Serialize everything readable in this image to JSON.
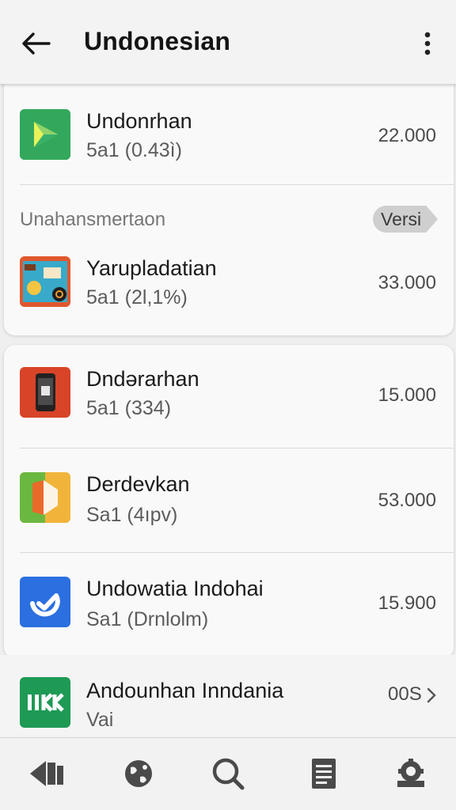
{
  "header": {
    "title": "Undonesian",
    "back_icon": "arrow-left-icon",
    "menu_icon": "more-vert-icon"
  },
  "card1": {
    "item1": {
      "name": "Undonrhan",
      "sub": "5a1 (0.43ì)",
      "price": "22.000",
      "icon": "play-store-icon"
    },
    "section_label": "Unahansmertaon",
    "badge": "Versi",
    "item2": {
      "name": "Yarupladatian",
      "sub": "5a1 (2l,1%)",
      "price": "33.000",
      "icon": "poster-app-icon"
    }
  },
  "card2": {
    "item1": {
      "name": "Dndərarhan",
      "sub": "5a1 (334)",
      "price": "15.000",
      "icon": "phone-app-icon"
    },
    "item2": {
      "name": "Derdevkan",
      "sub": "Sa1 (4ıpv)",
      "price": "53.000",
      "icon": "colorful-d-icon"
    },
    "item3": {
      "name": "Undowatia Indohai",
      "sub": "Sa1 (Drnlolm)",
      "price": "15.900",
      "icon": "blue-check-icon"
    }
  },
  "bottom_item": {
    "name": "Andounhan Inndania",
    "sub": "Vai",
    "price": "00S",
    "icon": "green-logo-icon"
  },
  "navbar": {
    "icons": [
      "back-nav-icon",
      "globe-icon",
      "search-icon",
      "document-icon",
      "settings-icon"
    ]
  },
  "colors": {
    "background": "#efefef",
    "card": "#f9f9f9",
    "play_green": "#2fa85a",
    "blue_accent": "#2a6fe0",
    "red_app": "#d94428"
  }
}
